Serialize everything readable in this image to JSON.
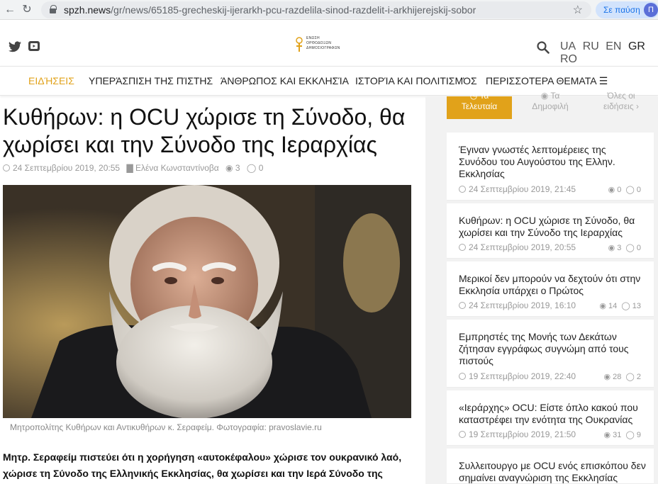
{
  "browser": {
    "url_domain": "spzh.news",
    "url_path": "/gr/news/65185-grecheskij-ijerarkh-pcu-razdelila-sinod-razdelit-i-arkhijerejskij-sobor",
    "pause_label": "Σε παύση",
    "avatar_letter": "Π"
  },
  "header": {
    "logo_text": "ΕΝΩΣΗ\nΟΡΘΟΔΟΞΩΝ\nΔΗΜΟΣΙΟΓΡΑΦΩΝ",
    "languages": [
      {
        "label": "UA",
        "active": false
      },
      {
        "label": "RU",
        "active": false
      },
      {
        "label": "EN",
        "active": false
      },
      {
        "label": "GR",
        "active": true
      },
      {
        "label": "RO",
        "active": false
      }
    ]
  },
  "nav": {
    "items": [
      "ΕΙΔΉΣΕΙΣ",
      "ΥΠΕΡΆΣΠΙΣΗ ΤΗΣ ΠΊΣΤΗΣ",
      "ΆΝΘΡΩΠΟΣ ΚΑΙ ΕΚΚΛΗΣΊΑ",
      "ΙΣΤΟΡΊΑ ΚΑΙ ΠΟΛΙΤΙΣΜΌΣ",
      "ΠΕΡΙΣΣΟΤΕΡΑ ΘΕΜΑΤΑ"
    ]
  },
  "article": {
    "title": "Κυθήρων: η OCU χώρισε τη Σύνοδο, θα χωρίσει και την Σύνοδο της Ιεραρχίας",
    "date": "24 Σεπτεμβρίου 2019, 20:55",
    "author": "Ελένα Κωνσταντίνοβα",
    "views": "3",
    "comments": "0",
    "caption": "Μητροπολίτης Κυθήρων και Αντικυθήρων κ. Σεραφείμ. Φωτογραφία: pravoslavie.ru",
    "lead": "Μητρ. Σεραφείμ πιστεύει ότι η χορήγηση «αυτοκέφαλου» χώρισε τον ουκρανικό λαό, χώρισε τη Σύνοδο της Ελληνικής Εκκλησίας, θα χωρίσει και την Ιερά Σύνοδο της Ιεραρχίας."
  },
  "sidebar": {
    "tabs": [
      {
        "line1": "Τα",
        "line2": "Τελευταία"
      },
      {
        "line1": "Τα",
        "line2": "Δημοφιλή"
      },
      {
        "line1": "Όλες οι",
        "line2": "ειδήσεις ›"
      }
    ],
    "items": [
      {
        "title": "Έγιναν γνωστές λεπτομέρειες της Συνόδου του Αυγούστου της Ελλην. Εκκλησίας",
        "date": "24 Σεπτεμβρίου 2019, 21:45",
        "views": "0",
        "comments": "0"
      },
      {
        "title": "Κυθήρων: η OCU χώρισε τη Σύνοδο, θα χωρίσει και την Σύνοδο της Ιεραρχίας",
        "date": "24 Σεπτεμβρίου 2019, 20:55",
        "views": "3",
        "comments": "0"
      },
      {
        "title": "Μερικοί δεν μπορούν να δεχτούν ότι στην Εκκλησία υπάρχει ο Πρώτος",
        "date": "24 Σεπτεμβρίου 2019, 16:10",
        "views": "14",
        "comments": "13"
      },
      {
        "title": "Εμπρηστές της Μονής των Δεκάτων ζήτησαν εγγράφως συγνώμη από τους πιστούς",
        "date": "19 Σεπτεμβρίου 2019, 22:40",
        "views": "28",
        "comments": "2"
      },
      {
        "title": "«Ιεράρχης» OCU: Είστε όπλο κακού που καταστρέφει την ενότητα της Ουκρανίας",
        "date": "19 Σεπτεμβρίου 2019, 21:50",
        "views": "31",
        "comments": "9"
      },
      {
        "title": "Συλλειτουργο με OCU ενός επισκόπου δεν σημαίνει αναγνώριση της Εκκλησίας",
        "date": "",
        "views": "",
        "comments": ""
      }
    ]
  }
}
